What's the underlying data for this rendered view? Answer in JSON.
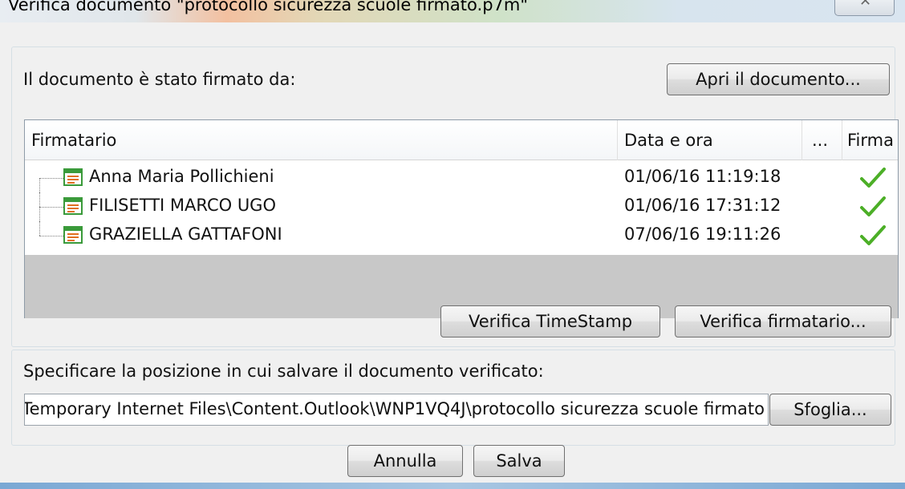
{
  "window": {
    "title": "Verifica documento \"protocollo sicurezza scuole firmato.p7m\"",
    "close_icon": "close-icon"
  },
  "signers_section": {
    "heading": "Il documento è stato firmato da:",
    "open_button": "Apri il documento...",
    "table": {
      "columns": [
        "Firmatario",
        "Data e ora",
        "...",
        "Firma"
      ],
      "rows": [
        {
          "name": "Anna Maria Pollichieni",
          "date": "01/06/16 11:19:18",
          "signature_icon": "check-icon"
        },
        {
          "name": "FILISETTI MARCO UGO",
          "date": "01/06/16 17:31:12",
          "signature_icon": "check-icon"
        },
        {
          "name": "GRAZIELLA GATTAFONI",
          "date": "07/06/16 19:11:26",
          "signature_icon": "check-icon"
        }
      ]
    },
    "verify_timestamp_button": "Verifica TimeStamp",
    "verify_signer_button": "Verifica firmatario..."
  },
  "save_section": {
    "heading": "Specificare la posizione in cui salvare il documento verificato:",
    "path_value": "Temporary Internet Files\\Content.Outlook\\WNP1VQ4J\\protocollo sicurezza scuole firmato",
    "browse_button": "Sfoglia..."
  },
  "footer": {
    "cancel_button": "Annulla",
    "save_button": "Salva"
  },
  "colors": {
    "check_green": "#4caf27",
    "cert_green": "#3a9a3a",
    "gray_area": "#c8c8c8"
  }
}
